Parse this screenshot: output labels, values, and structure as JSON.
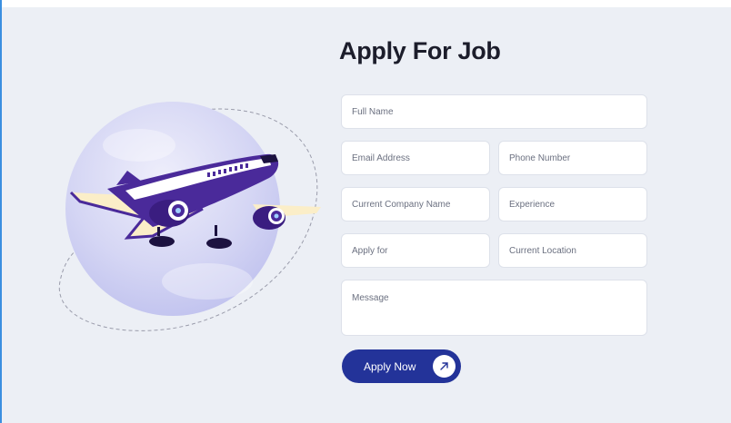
{
  "form": {
    "title": "Apply For Job",
    "full_name_placeholder": "Full Name",
    "email_placeholder": "Email Address",
    "phone_placeholder": "Phone Number",
    "company_placeholder": "Current Company Name",
    "experience_placeholder": "Experience",
    "apply_for_placeholder": "Apply for",
    "location_placeholder": "Current Location",
    "message_placeholder": "Message",
    "submit_label": "Apply Now",
    "submit_icon": "arrow-up-right-icon"
  },
  "illustration": {
    "name": "airplane-illustration"
  },
  "colors": {
    "background": "#eceff5",
    "button": "#233399",
    "title": "#1c1d2b",
    "plane_body": "#4a2a9a",
    "plane_wing": "#fbeec8",
    "globe": "#d7d9f5"
  }
}
